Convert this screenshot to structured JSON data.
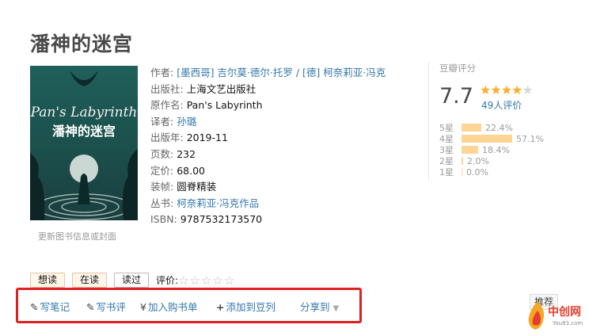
{
  "title": "潘神的迷宫",
  "cover": {
    "title_en": "Pan's Labyrinth",
    "title_cn": "潘神的迷宫",
    "caption": "更新图书信息或封面"
  },
  "info": {
    "author_label": "作者:",
    "author_value": "[墨西哥] 吉尔莫·德尔·托罗 / [德] 柯奈莉亚·冯克",
    "publisher_label": "出版社:",
    "publisher_value": "上海文艺出版社",
    "original_label": "原作名:",
    "original_value": "Pan's Labyrinth",
    "translator_label": "译者:",
    "translator_value": "孙璐",
    "year_label": "出版年:",
    "year_value": "2019-11",
    "pages_label": "页数:",
    "pages_value": "232",
    "price_label": "定价:",
    "price_value": "68.00",
    "binding_label": "装帧:",
    "binding_value": "圆脊精装",
    "series_label": "丛书:",
    "series_value": "柯奈莉亚·冯克作品",
    "isbn_label": "ISBN:",
    "isbn_value": "9787532173570"
  },
  "rating": {
    "head": "豆瓣评分",
    "score": "7.7",
    "stars_on": "★★★★",
    "stars_off": "★",
    "count": "49人评价",
    "breakdown": [
      {
        "label": "5星",
        "percent": 22.4,
        "text": "22.4%"
      },
      {
        "label": "4星",
        "percent": 57.1,
        "text": "57.1%"
      },
      {
        "label": "3星",
        "percent": 18.4,
        "text": "18.4%"
      },
      {
        "label": "2星",
        "percent": 2.0,
        "text": "2.0%"
      },
      {
        "label": "1星",
        "percent": 0.0,
        "text": "0.0%"
      }
    ]
  },
  "buttons": {
    "want": "想读",
    "reading": "在读",
    "read": "读过",
    "rate_label": "评价:",
    "rate_stars": "☆☆☆☆☆"
  },
  "actions": {
    "note": "写笔记",
    "review": "写书评",
    "cart": "加入购书单",
    "doulist": "添加到豆列",
    "share": "分享到"
  },
  "recommend": "推荐",
  "watermark": {
    "text": "中创网",
    "sub": "You83.com"
  },
  "colors": {
    "link": "#3377aa",
    "star": "#ffac2d",
    "bar": "#ffd596",
    "highlight": "#e02020"
  }
}
